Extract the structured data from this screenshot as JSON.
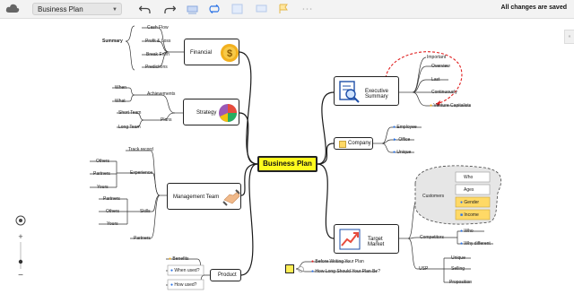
{
  "toolbar": {
    "doc_title": "Business Plan",
    "save_status": "All changes are saved",
    "icons": [
      "cloud-icon",
      "undo-icon",
      "redo-icon",
      "format-icon",
      "relayout-icon",
      "sheet-icon",
      "flag-icon",
      "more-icon"
    ]
  },
  "map": {
    "central": "Business Plan",
    "financial": {
      "title": "Financial",
      "summary": "Summary",
      "children": [
        "Cash Flow",
        "Profit & Loss",
        "Break Even",
        "Predictions"
      ]
    },
    "strategy": {
      "title": "Strategy",
      "achievements": "Achievements",
      "when": "When",
      "what": "What",
      "plans": "Plans",
      "short_team": "Short Team",
      "long_team": "Long Team"
    },
    "management": {
      "title": "Management Team",
      "track_record": "Track record",
      "experience": "Experience",
      "others": "Others",
      "partners": "Partners",
      "yours": "Yours",
      "skills": "Skills",
      "partners2": "Partners",
      "others2": "Others",
      "yours2": "Yours",
      "partners3": "Partners"
    },
    "product": {
      "title": "Product",
      "benefits": "Benefits",
      "when_used": "When used?",
      "how_used": "How used?"
    },
    "executive": {
      "title": "Executive Summary",
      "important": "Important",
      "overview": "Overview",
      "last": "Last",
      "continuously": "Continuously",
      "venture": "Venture Capitalists"
    },
    "company": {
      "title": "Company",
      "employee": "Employee",
      "office": "Office",
      "unique": "Unique"
    },
    "target": {
      "title": "Target Market",
      "customers": "Customers",
      "who": "Who",
      "ages": "Ages",
      "gender": "Gender",
      "income": "Income",
      "competitors": "Competitors",
      "who2": "Who",
      "why_different": "Why different",
      "usp": "USP",
      "unique": "Unique",
      "selling": "Selling",
      "proposition": "Proposition"
    },
    "notes": {
      "before": "Before Writing Your Plan",
      "how_long": "How Long Should Your Plan Be?"
    }
  },
  "colors": {
    "central_fill": "#fffa1e",
    "highlight_fill": "#ffd966",
    "relation_line": "#e02020",
    "dashed_group": "#e6e6e6",
    "accent_blue": "#2b73e6"
  }
}
